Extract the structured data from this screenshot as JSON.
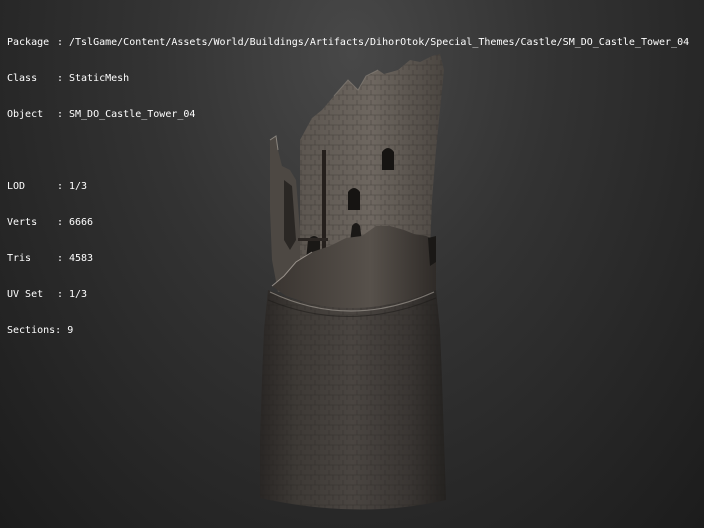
{
  "overlay": {
    "separator": ":",
    "asset": [
      {
        "key": "Package",
        "value": "/TslGame/Content/Assets/World/Buildings/Artifacts/DihorOtok/Special_Themes/Castle/SM_DO_Castle_Tower_04"
      },
      {
        "key": "Class",
        "value": "StaticMesh"
      },
      {
        "key": "Object",
        "value": "SM_DO_Castle_Tower_04"
      }
    ],
    "stats": [
      {
        "key": "LOD",
        "value": "1/3"
      },
      {
        "key": "Verts",
        "value": "6666"
      },
      {
        "key": "Tris",
        "value": "4583"
      },
      {
        "key": "UV Set",
        "value": "1/3"
      },
      {
        "key": "Sections",
        "value": "9"
      }
    ]
  },
  "colors": {
    "overlay_text": "#ffffff",
    "background_center": "#484848",
    "background_edge": "#1c1c1c"
  },
  "icons": {
    "preview": "castle-tower-mesh"
  }
}
